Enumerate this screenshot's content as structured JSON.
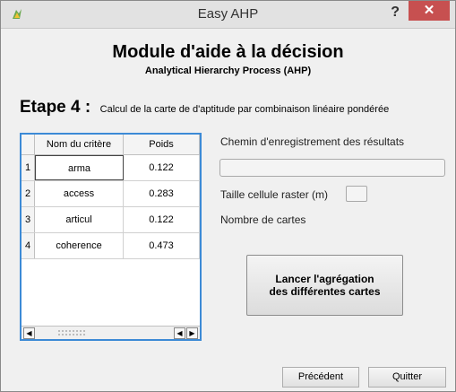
{
  "window": {
    "title": "Easy AHP",
    "help_label": "?",
    "close_label": "✕"
  },
  "header": {
    "title": "Module d'aide à la décision",
    "subtitle": "Analytical Hierarchy Process (AHP)"
  },
  "step": {
    "title": "Etape 4 :",
    "description": "Calcul de la carte de d'aptitude par combinaison linéaire pondérée"
  },
  "table": {
    "headers": [
      "Nom du critère",
      "Poids"
    ],
    "rows": [
      {
        "num": "1",
        "name": "arma",
        "weight": "0.122"
      },
      {
        "num": "2",
        "name": "access",
        "weight": "0.283"
      },
      {
        "num": "3",
        "name": "articul",
        "weight": "0.122"
      },
      {
        "num": "4",
        "name": "coherence",
        "weight": "0.473"
      }
    ],
    "scroll_left": "◀",
    "scroll_right": "▶"
  },
  "form": {
    "path_label": "Chemin d'enregistrement des résultats",
    "path_value": "",
    "cell_size_label": "Taille cellule raster (m)",
    "cell_size_value": "",
    "map_count_label": "Nombre de cartes"
  },
  "actions": {
    "aggregate_line1": "Lancer l'agrégation",
    "aggregate_line2": "des différentes cartes",
    "previous": "Précédent",
    "quit": "Quitter"
  }
}
